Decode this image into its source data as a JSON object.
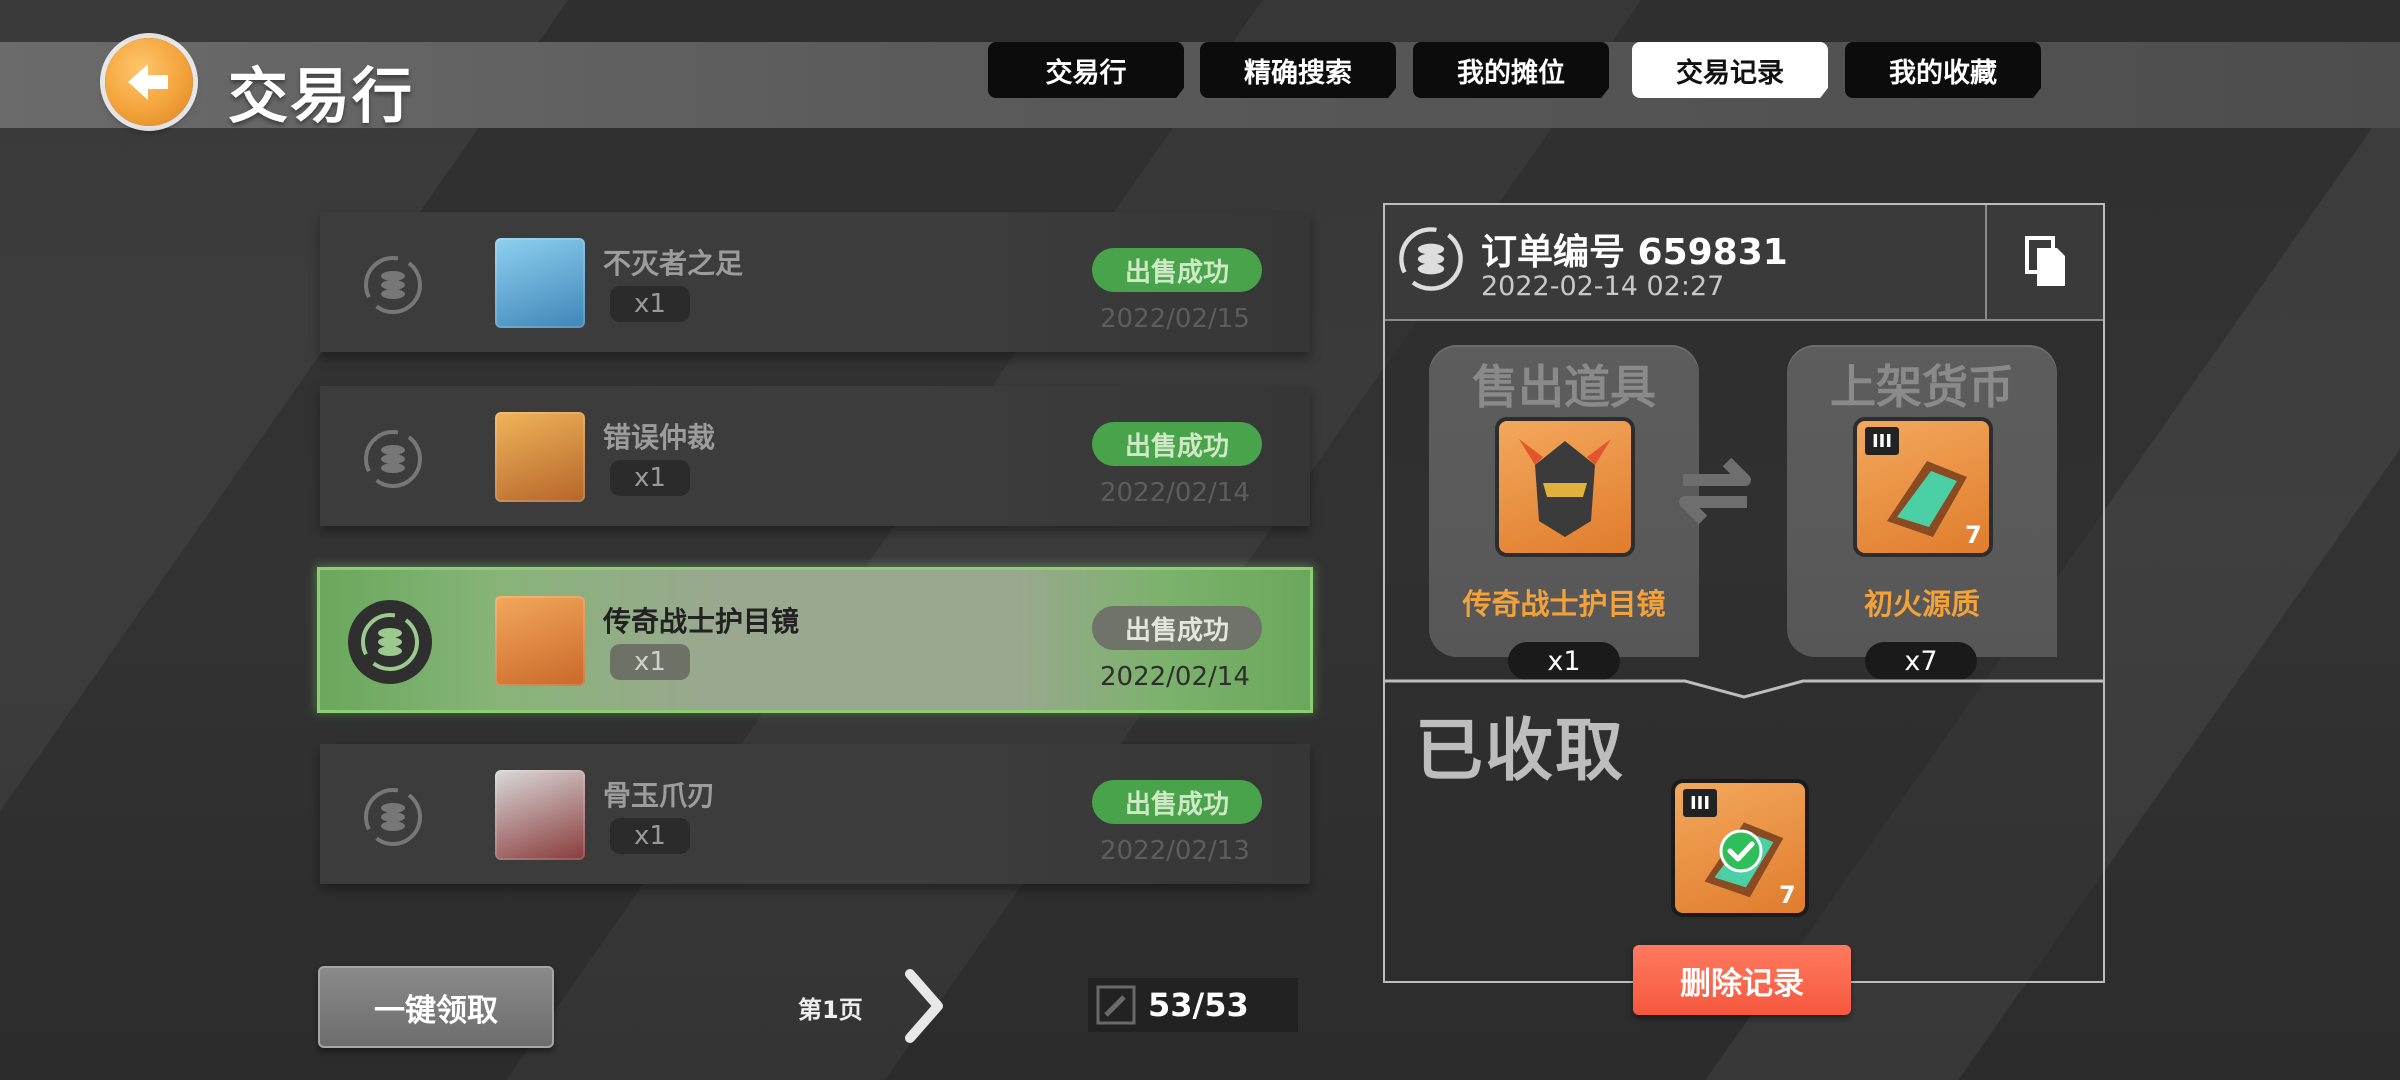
{
  "header": {
    "title": "交易行",
    "tabs": [
      {
        "label": "交易行",
        "active": false
      },
      {
        "label": "精确搜索",
        "active": false
      },
      {
        "label": "我的摊位",
        "active": false
      },
      {
        "label": "交易记录",
        "active": true
      },
      {
        "label": "我的收藏",
        "active": false
      }
    ]
  },
  "records": [
    {
      "name": "不灭者之足",
      "qty": "x1",
      "status": "出售成功",
      "date": "2022/02/15",
      "selected": false,
      "thumb_color": "#5fa8d3"
    },
    {
      "name": "错误仲裁",
      "qty": "x1",
      "status": "出售成功",
      "date": "2022/02/14",
      "selected": false,
      "thumb_color": "#e79a3b"
    },
    {
      "name": "传奇战士护目镜",
      "qty": "x1",
      "status": "出售成功",
      "date": "2022/02/14",
      "selected": true,
      "thumb_color": "#e88a35"
    },
    {
      "name": "骨玉爪刃",
      "qty": "x1",
      "status": "出售成功",
      "date": "2022/02/13",
      "selected": false,
      "thumb_color": "#b7b7b7"
    }
  ],
  "footer": {
    "claim_all_label": "一键领取",
    "page_label": "第1页",
    "count": "53/53"
  },
  "detail": {
    "order_label": "订单编号 659831",
    "datetime": "2022-02-14 02:27",
    "sold_item_title": "售出道具",
    "sold_item_name": "传奇战士护目镜",
    "sold_item_qty": "x1",
    "currency_title": "上架货币",
    "currency_name": "初火源质",
    "currency_qty": "x7",
    "currency_tier": "III",
    "currency_badge": "7",
    "collected_label": "已收取",
    "collected_tier": "III",
    "collected_badge": "7",
    "delete_label": "删除记录"
  },
  "colors": {
    "status_green": "#49a34a",
    "accent_orange": "#f2a13b",
    "delete_red": "#f5583e",
    "tab_active_bg": "#ffffff",
    "tab_bg": "#0c0c0c"
  },
  "icons": [
    "back-arrow-icon",
    "coin-stack-icon",
    "copy-icon",
    "exchange-arrows-icon",
    "next-chevron-icon",
    "check-icon",
    "edit-icon"
  ]
}
